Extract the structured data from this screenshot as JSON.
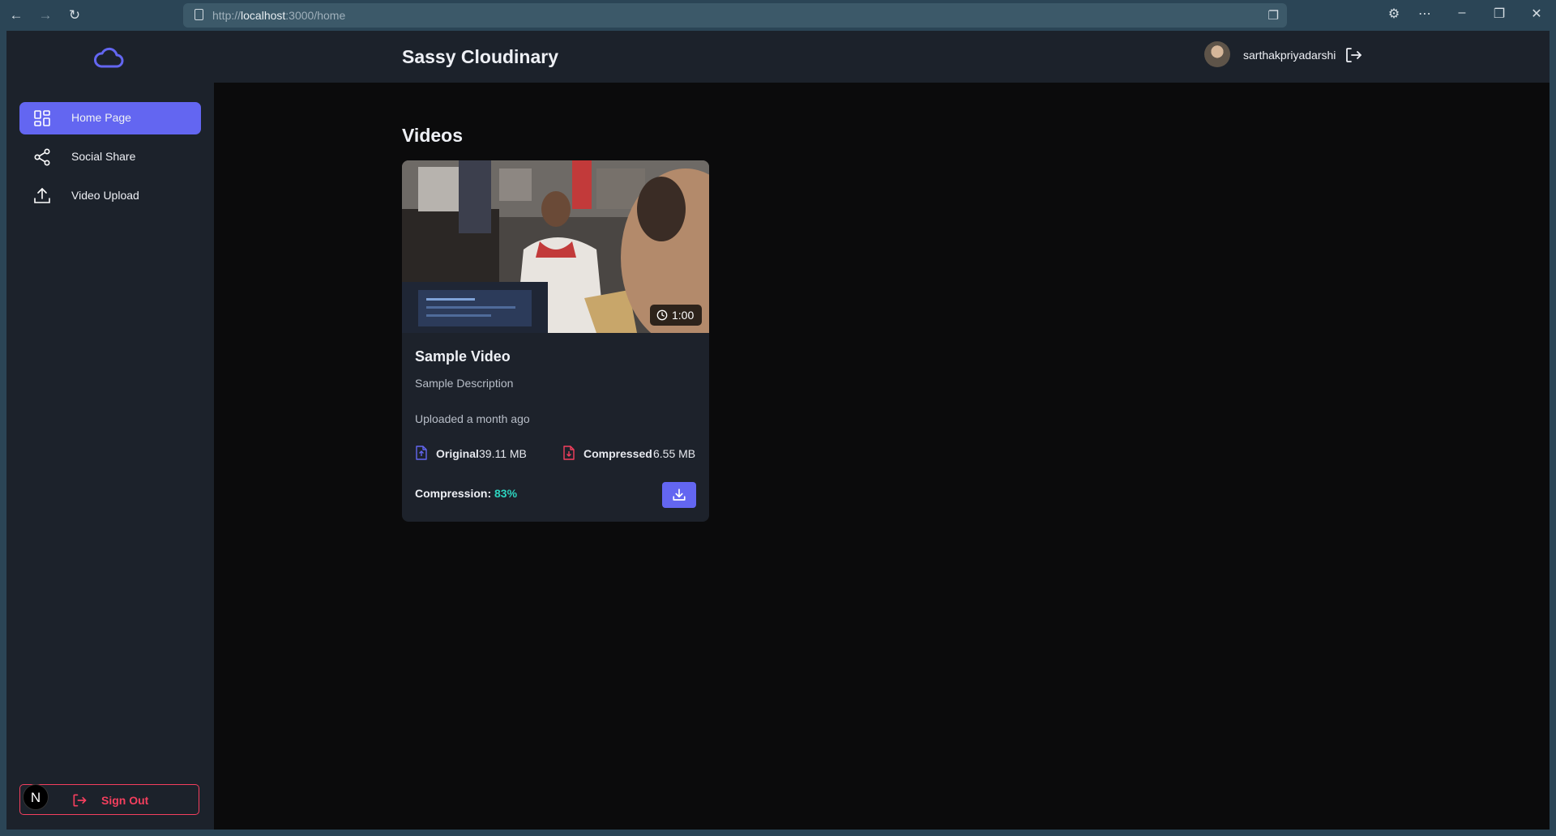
{
  "browser": {
    "url_prefix": "http://",
    "url_host": "localhost",
    "url_rest": ":3000/home"
  },
  "sidebar": {
    "items": [
      {
        "label": "Home Page",
        "icon": "grid-icon",
        "active": true
      },
      {
        "label": "Social Share",
        "icon": "share-icon",
        "active": false
      },
      {
        "label": "Video Upload",
        "icon": "upload-icon",
        "active": false
      }
    ],
    "sign_out_label": "Sign Out",
    "next_badge": "N"
  },
  "header": {
    "title": "Sassy Cloudinary",
    "username": "sarthakpriyadarshi"
  },
  "main": {
    "section_title": "Videos",
    "videos": [
      {
        "title": "Sample Video",
        "description": "Sample Description",
        "uploaded": "Uploaded a month ago",
        "duration": "1:00",
        "original_label": "Original",
        "original_size": "39.11 MB",
        "compressed_label": "Compressed",
        "compressed_size": "6.55 MB",
        "compression_label": "Compression:",
        "compression_value": "83%"
      }
    ]
  },
  "colors": {
    "accent": "#6366f1",
    "danger": "#f43f5e",
    "success": "#2dd4bf",
    "sidebar_bg": "#1c222b",
    "content_bg": "#0b0b0c"
  }
}
